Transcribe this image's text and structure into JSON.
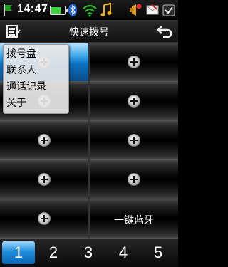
{
  "status_bar": {
    "time": "14:47",
    "battery_level": 0.8,
    "icons": [
      "flag-icon",
      "battery-icon",
      "bluetooth-icon",
      "wifi-icon",
      "music-icon",
      "notification-icon",
      "message-icon",
      "settings-icon"
    ]
  },
  "title_bar": {
    "title": "快速拨号",
    "menu_icon": "menu-icon",
    "back_icon": "back-icon"
  },
  "popup_menu": {
    "items": [
      "拨号盘",
      "联系人",
      "通话记录",
      "关于"
    ]
  },
  "speed_dial": {
    "cells": [
      {
        "label": "",
        "state": "selected"
      },
      {
        "label": "",
        "state": "empty"
      },
      {
        "label": "",
        "state": "empty"
      },
      {
        "label": "",
        "state": "empty"
      },
      {
        "label": "",
        "state": "empty"
      },
      {
        "label": "",
        "state": "empty"
      },
      {
        "label": "",
        "state": "empty"
      },
      {
        "label": "",
        "state": "empty"
      },
      {
        "label": "",
        "state": "empty"
      },
      {
        "label": "一键蓝牙",
        "state": "assigned"
      }
    ]
  },
  "pager": {
    "pages": [
      "1",
      "2",
      "3",
      "4",
      "5"
    ],
    "active": "1"
  },
  "colors": {
    "accent": "#1d8edc",
    "background": "#000000"
  }
}
